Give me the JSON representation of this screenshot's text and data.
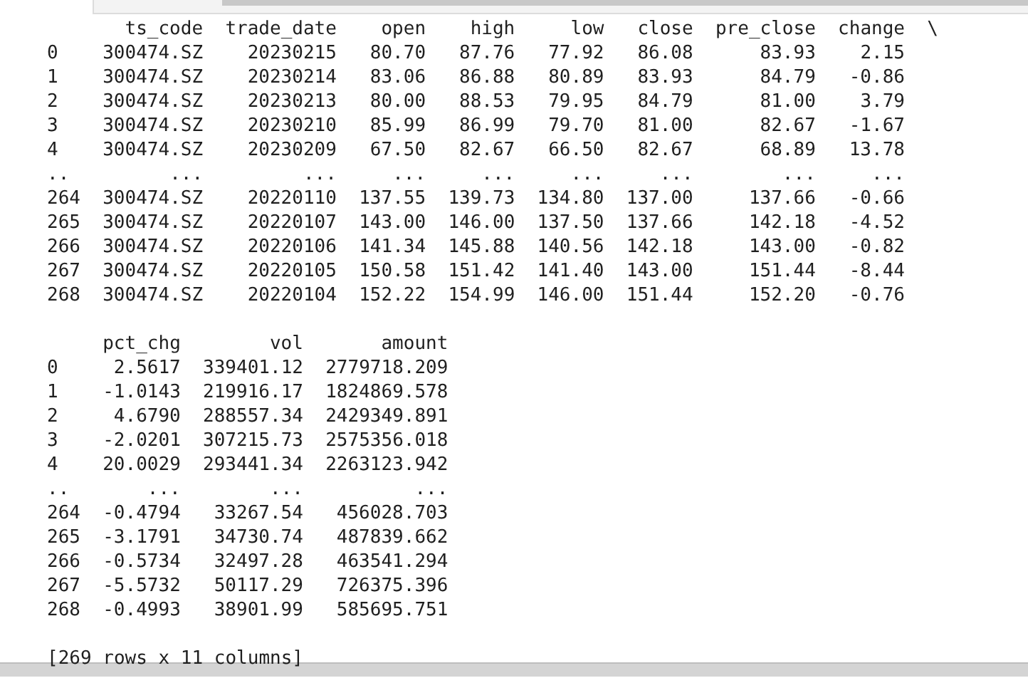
{
  "output_blocks": [
    {
      "columns": [
        "ts_code",
        "trade_date",
        "open",
        "high",
        "low",
        "close",
        "pre_close",
        "change"
      ],
      "continuation_mark": "\\",
      "rows": [
        {
          "index": "0",
          "cells": [
            "300474.SZ",
            "20230215",
            "80.70",
            "87.76",
            "77.92",
            "86.08",
            "83.93",
            "2.15"
          ]
        },
        {
          "index": "1",
          "cells": [
            "300474.SZ",
            "20230214",
            "83.06",
            "86.88",
            "80.89",
            "83.93",
            "84.79",
            "-0.86"
          ]
        },
        {
          "index": "2",
          "cells": [
            "300474.SZ",
            "20230213",
            "80.00",
            "88.53",
            "79.95",
            "84.79",
            "81.00",
            "3.79"
          ]
        },
        {
          "index": "3",
          "cells": [
            "300474.SZ",
            "20230210",
            "85.99",
            "86.99",
            "79.70",
            "81.00",
            "82.67",
            "-1.67"
          ]
        },
        {
          "index": "4",
          "cells": [
            "300474.SZ",
            "20230209",
            "67.50",
            "82.67",
            "66.50",
            "82.67",
            "68.89",
            "13.78"
          ]
        },
        {
          "index": "..",
          "cells": [
            "...",
            "...",
            "...",
            "...",
            "...",
            "...",
            "...",
            "..."
          ]
        },
        {
          "index": "264",
          "cells": [
            "300474.SZ",
            "20220110",
            "137.55",
            "139.73",
            "134.80",
            "137.00",
            "137.66",
            "-0.66"
          ]
        },
        {
          "index": "265",
          "cells": [
            "300474.SZ",
            "20220107",
            "143.00",
            "146.00",
            "137.50",
            "137.66",
            "142.18",
            "-4.52"
          ]
        },
        {
          "index": "266",
          "cells": [
            "300474.SZ",
            "20220106",
            "141.34",
            "145.88",
            "140.56",
            "142.18",
            "143.00",
            "-0.82"
          ]
        },
        {
          "index": "267",
          "cells": [
            "300474.SZ",
            "20220105",
            "150.58",
            "151.42",
            "141.40",
            "143.00",
            "151.44",
            "-8.44"
          ]
        },
        {
          "index": "268",
          "cells": [
            "300474.SZ",
            "20220104",
            "152.22",
            "154.99",
            "146.00",
            "151.44",
            "152.20",
            "-0.76"
          ]
        }
      ]
    },
    {
      "columns": [
        "pct_chg",
        "vol",
        "amount"
      ],
      "rows": [
        {
          "index": "0",
          "cells": [
            "2.5617",
            "339401.12",
            "2779718.209"
          ]
        },
        {
          "index": "1",
          "cells": [
            "-1.0143",
            "219916.17",
            "1824869.578"
          ]
        },
        {
          "index": "2",
          "cells": [
            "4.6790",
            "288557.34",
            "2429349.891"
          ]
        },
        {
          "index": "3",
          "cells": [
            "-2.0201",
            "307215.73",
            "2575356.018"
          ]
        },
        {
          "index": "4",
          "cells": [
            "20.0029",
            "293441.34",
            "2263123.942"
          ]
        },
        {
          "index": "..",
          "cells": [
            "...",
            "...",
            "..."
          ]
        },
        {
          "index": "264",
          "cells": [
            "-0.4794",
            "33267.54",
            "456028.703"
          ]
        },
        {
          "index": "265",
          "cells": [
            "-3.1791",
            "34730.74",
            "487839.662"
          ]
        },
        {
          "index": "266",
          "cells": [
            "-0.5734",
            "32497.28",
            "463541.294"
          ]
        },
        {
          "index": "267",
          "cells": [
            "-5.5732",
            "50117.29",
            "726375.396"
          ]
        },
        {
          "index": "268",
          "cells": [
            "-0.4993",
            "38901.99",
            "585695.751"
          ]
        }
      ]
    }
  ],
  "footer": "[269 rows x 11 columns]"
}
